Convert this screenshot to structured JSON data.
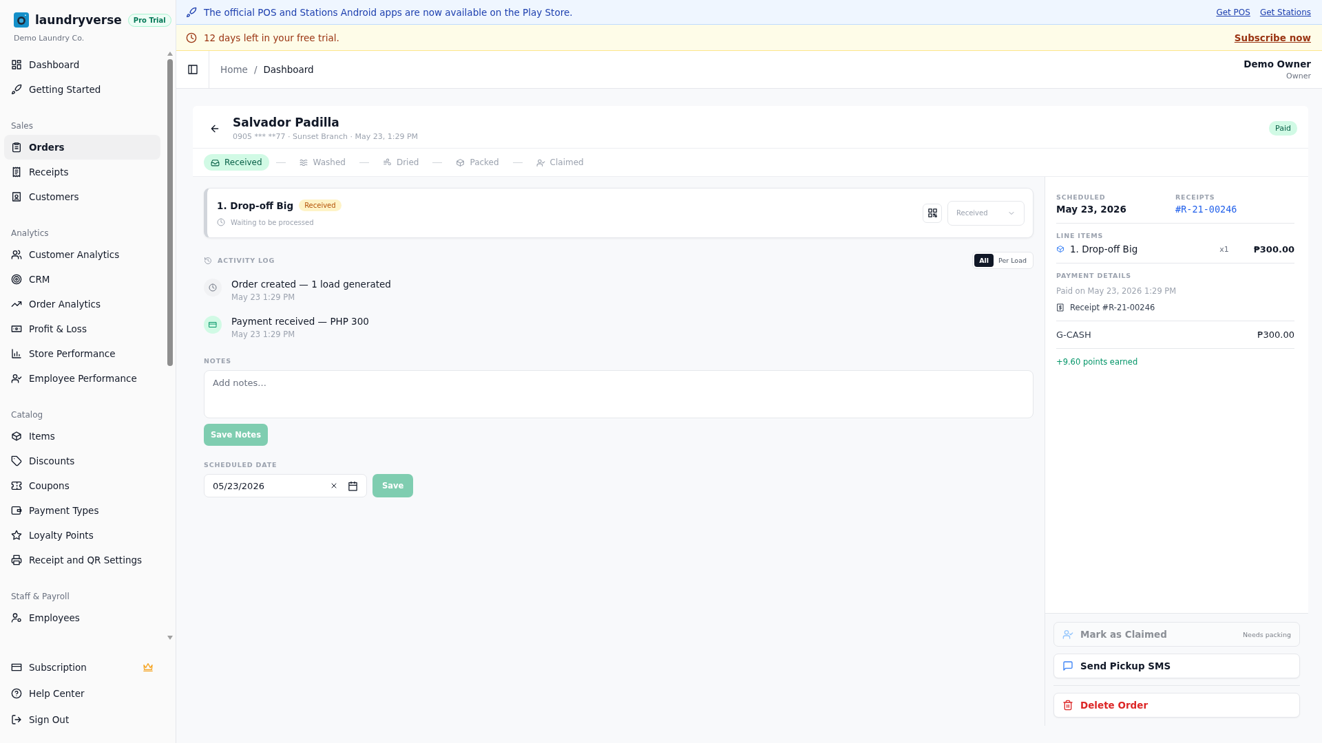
{
  "brand": {
    "name": "laundryverse",
    "plan_badge": "Pro Trial",
    "company": "Demo Laundry Co."
  },
  "sidebar": {
    "sections": [
      {
        "items": [
          {
            "label": "Dashboard",
            "selected": false
          },
          {
            "label": "Getting Started",
            "selected": false
          }
        ]
      },
      {
        "title": "Sales",
        "items": [
          {
            "label": "Orders",
            "selected": true
          },
          {
            "label": "Receipts",
            "selected": false
          },
          {
            "label": "Customers",
            "selected": false
          }
        ]
      },
      {
        "title": "Analytics",
        "items": [
          {
            "label": "Customer Analytics",
            "selected": false
          },
          {
            "label": "CRM",
            "selected": false
          },
          {
            "label": "Order Analytics",
            "selected": false
          },
          {
            "label": "Profit & Loss",
            "selected": false
          },
          {
            "label": "Store Performance",
            "selected": false
          },
          {
            "label": "Employee Performance",
            "selected": false
          }
        ]
      },
      {
        "title": "Catalog",
        "items": [
          {
            "label": "Items",
            "selected": false
          },
          {
            "label": "Discounts",
            "selected": false
          },
          {
            "label": "Coupons",
            "selected": false
          },
          {
            "label": "Payment Types",
            "selected": false
          },
          {
            "label": "Loyalty Points",
            "selected": false
          },
          {
            "label": "Receipt and QR Settings",
            "selected": false
          }
        ]
      },
      {
        "title": "Staff & Payroll",
        "items": [
          {
            "label": "Employees",
            "selected": false
          }
        ]
      }
    ],
    "footer_items": [
      {
        "label": "Subscription",
        "premium": true
      },
      {
        "label": "Help Center",
        "premium": false
      },
      {
        "label": "Sign Out",
        "premium": false
      }
    ]
  },
  "announcement": {
    "text": "The official POS and Stations Android apps are now available on the Play Store.",
    "links": [
      "Get POS",
      "Get Stations"
    ]
  },
  "trial_banner": {
    "text": "12 days left in your free trial.",
    "link": "Subscribe now"
  },
  "header": {
    "breadcrumb": [
      "Home",
      "Dashboard"
    ],
    "breadcrumb_separator": "/",
    "user": {
      "name": "Demo Owner",
      "role": "Owner"
    }
  },
  "order": {
    "customer": "Salvador Padilla",
    "meta": "0905 *** **77 · Sunset Branch · May 23, 1:29 PM",
    "payment_status": "Paid",
    "steps": [
      {
        "label": "Received",
        "selected": true
      },
      {
        "label": "Washed",
        "selected": false
      },
      {
        "label": "Dried",
        "selected": false
      },
      {
        "label": "Packed",
        "selected": false
      },
      {
        "label": "Claimed",
        "selected": false
      }
    ],
    "loads": [
      {
        "title": "1. Drop-off Big",
        "status": "Received",
        "note": "Waiting to be processed",
        "status_select": "Received"
      }
    ],
    "activity_log": {
      "title": "ACTIVITY LOG",
      "filters": [
        {
          "label": "All",
          "selected": true
        },
        {
          "label": "Per Load",
          "selected": false
        }
      ],
      "entries": [
        {
          "kind": "created",
          "text": "Order created — 1 load generated",
          "time": "May 23 1:29 PM"
        },
        {
          "kind": "payment",
          "text": "Payment received — PHP 300",
          "time": "May 23 1:29 PM"
        }
      ]
    },
    "notes": {
      "label": "NOTES",
      "placeholder": "Add notes...",
      "button": "Save Notes"
    },
    "scheduled_date": {
      "label": "SCHEDULED DATE",
      "value": "05/23/2026",
      "button": "Save"
    }
  },
  "summary": {
    "scheduled_label": "SCHEDULED",
    "scheduled": "May 23, 2026",
    "receipts_label": "RECEIPTS",
    "receipt": "#R-21-00246",
    "line_items_label": "LINE ITEMS",
    "line_items": [
      {
        "name": "1. Drop-off Big",
        "qty": "x1",
        "amount": "₱300.00"
      }
    ],
    "payment_label": "PAYMENT DETAILS",
    "paid_on": "Paid on May 23, 2026 1:29 PM",
    "receipt_ref": "Receipt #R-21-00246",
    "payments": [
      {
        "method": "G-CASH",
        "amount": "₱300.00"
      }
    ],
    "points": "+9.60 points earned"
  },
  "actions": [
    {
      "kind": "claim",
      "label": "Mark as Claimed",
      "hint": "Needs packing",
      "disabled": true
    },
    {
      "kind": "sms",
      "label": "Send Pickup SMS",
      "disabled": false
    },
    {
      "kind": "delete",
      "label": "Delete Order",
      "disabled": false
    }
  ]
}
